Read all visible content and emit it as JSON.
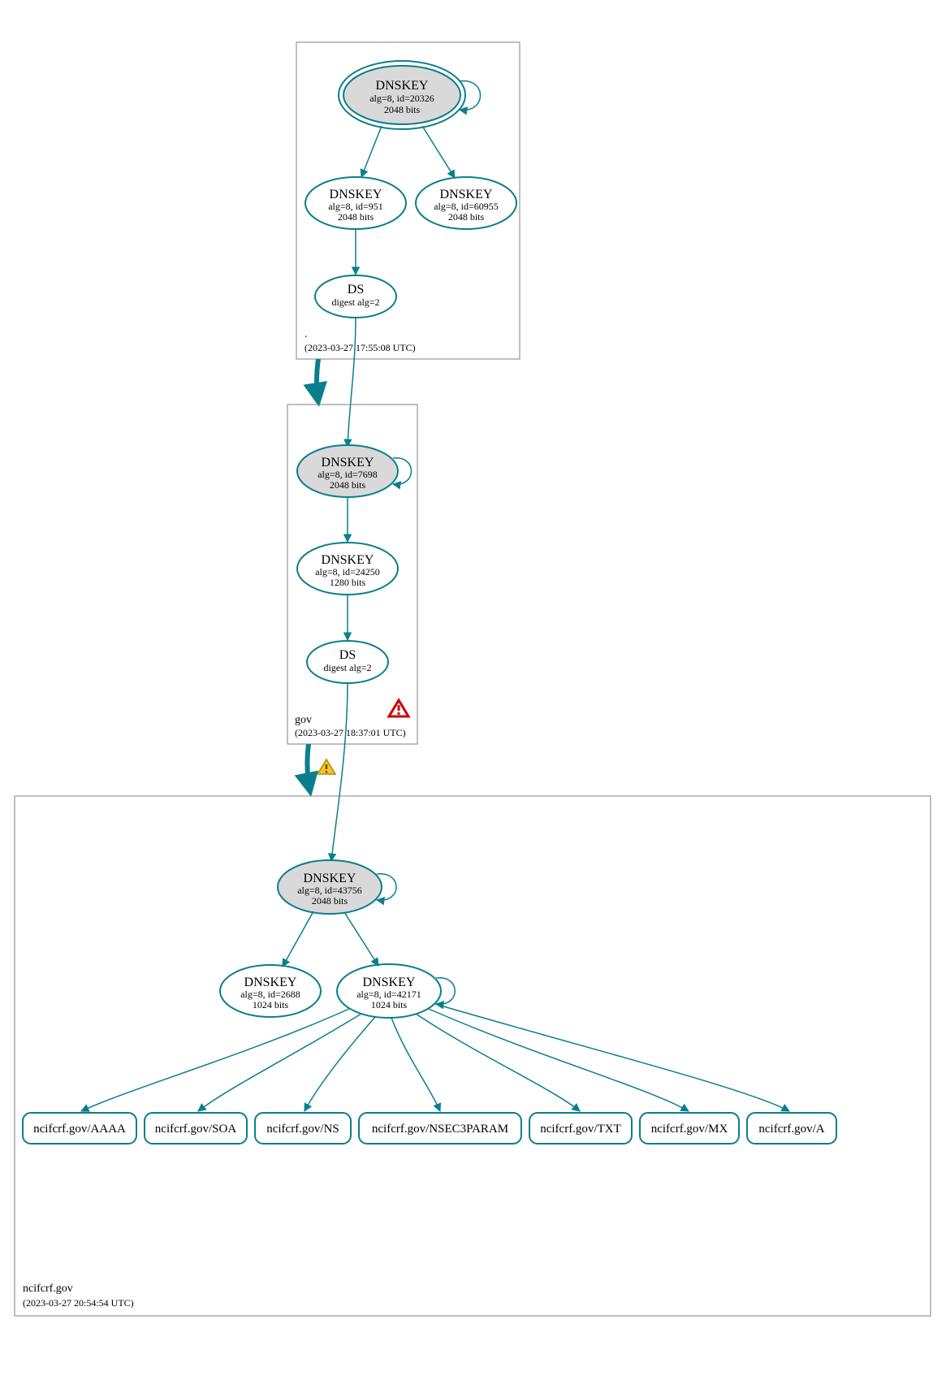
{
  "zones": {
    "root": {
      "name": ".",
      "timestamp": "(2023-03-27 17:55:08 UTC)",
      "ksk": {
        "title": "DNSKEY",
        "line1": "alg=8, id=20326",
        "line2": "2048 bits"
      },
      "zsk1": {
        "title": "DNSKEY",
        "line1": "alg=8, id=951",
        "line2": "2048 bits"
      },
      "zsk2": {
        "title": "DNSKEY",
        "line1": "alg=8, id=60955",
        "line2": "2048 bits"
      },
      "ds": {
        "title": "DS",
        "line1": "digest alg=2"
      }
    },
    "gov": {
      "name": "gov",
      "timestamp": "(2023-03-27 18:37:01 UTC)",
      "ksk": {
        "title": "DNSKEY",
        "line1": "alg=8, id=7698",
        "line2": "2048 bits"
      },
      "zsk": {
        "title": "DNSKEY",
        "line1": "alg=8, id=24250",
        "line2": "1280 bits"
      },
      "ds": {
        "title": "DS",
        "line1": "digest alg=2"
      }
    },
    "ncifcrf": {
      "name": "ncifcrf.gov",
      "timestamp": "(2023-03-27 20:54:54 UTC)",
      "ksk": {
        "title": "DNSKEY",
        "line1": "alg=8, id=43756",
        "line2": "2048 bits"
      },
      "zsk1": {
        "title": "DNSKEY",
        "line1": "alg=8, id=2688",
        "line2": "1024 bits"
      },
      "zsk2": {
        "title": "DNSKEY",
        "line1": "alg=8, id=42171",
        "line2": "1024 bits"
      },
      "rrsets": [
        "ncifcrf.gov/AAAA",
        "ncifcrf.gov/SOA",
        "ncifcrf.gov/NS",
        "ncifcrf.gov/NSEC3PARAM",
        "ncifcrf.gov/TXT",
        "ncifcrf.gov/MX",
        "ncifcrf.gov/A"
      ]
    }
  },
  "colors": {
    "teal": "#0a7e8c",
    "grey_fill": "#d9d9d9",
    "warn_red": "#cc0000",
    "warn_yellow": "#f4c430"
  }
}
